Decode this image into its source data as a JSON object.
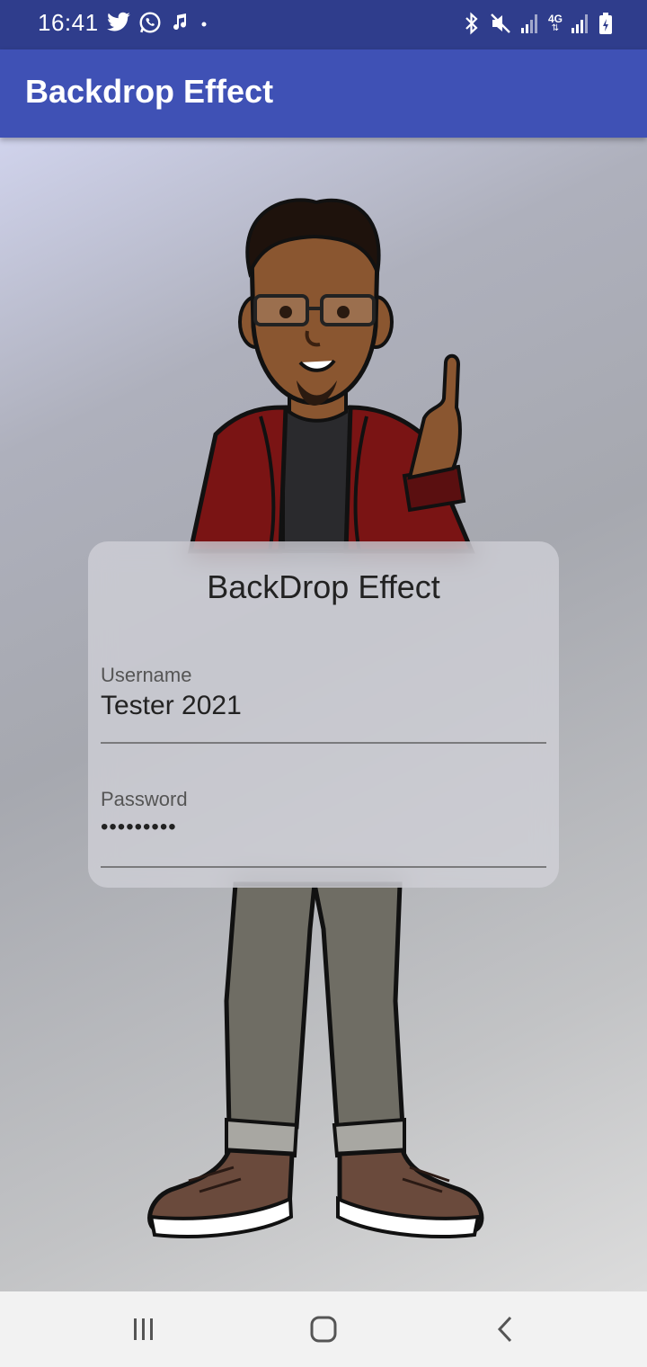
{
  "status_bar": {
    "time": "16:41",
    "left_icons": [
      "twitter-icon",
      "whatsapp-icon",
      "music-icon",
      "dot-icon"
    ],
    "right_icons": [
      "bluetooth-icon",
      "mute-icon",
      "signal-icon",
      "4g-icon",
      "signal-icon",
      "battery-icon"
    ],
    "network_label": "4G"
  },
  "app_bar": {
    "title": "Backdrop Effect"
  },
  "card": {
    "title": "BackDrop Effect",
    "username": {
      "label": "Username",
      "value": "Tester 2021"
    },
    "password": {
      "label": "Password",
      "value": "•••••••••"
    }
  },
  "nav_bar": {
    "items": [
      "recent-apps-icon",
      "home-icon",
      "back-icon"
    ]
  },
  "colors": {
    "app_bar": "#3f51b5",
    "status_bar": "#2f3d8c",
    "jacket": "#7a1414",
    "pants": "#6f6d64"
  }
}
